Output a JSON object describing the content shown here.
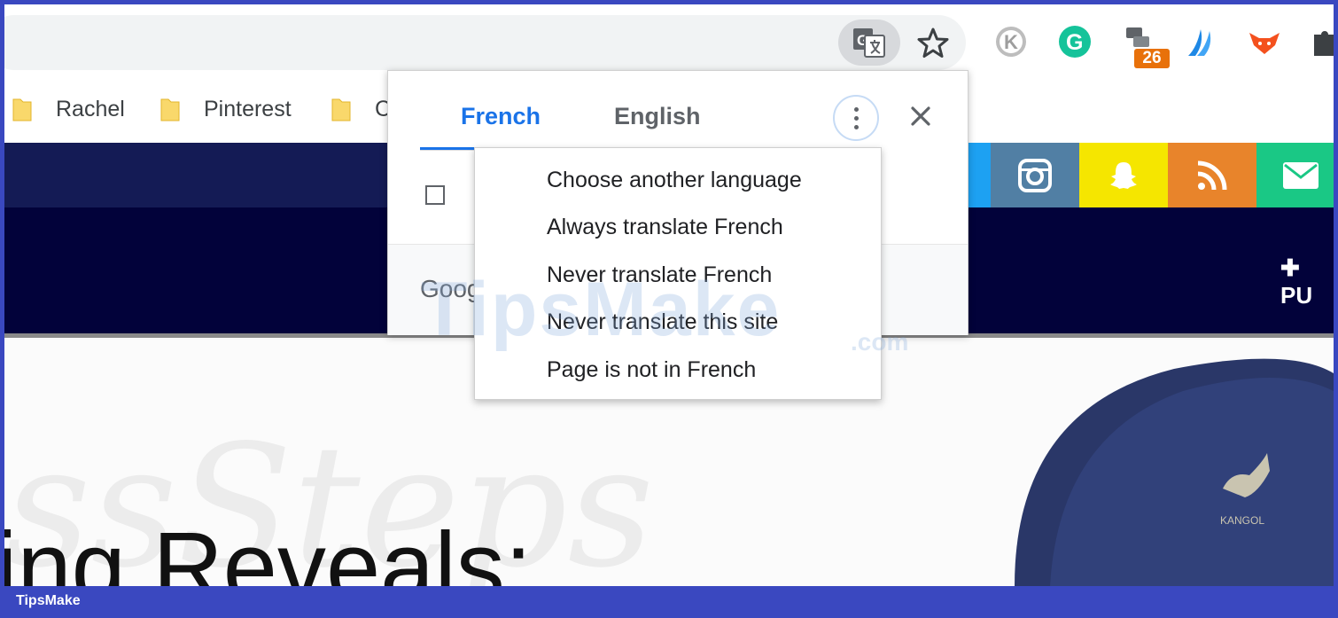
{
  "toolbar": {
    "translate_icon": "translate-icon",
    "bookmark_icon": "star-icon",
    "extensions": [
      {
        "name": "k-extension-icon",
        "letter": "K",
        "color": "#9e9e9e"
      },
      {
        "name": "grammarly-icon",
        "letter": "G",
        "color": "#15c39a"
      },
      {
        "name": "tab-manager-icon",
        "badge": "26",
        "badge_color": "#e8710a"
      },
      {
        "name": "wing-extension-icon",
        "color": "#1e88e5"
      },
      {
        "name": "fox-extension-icon",
        "color": "#f4511e"
      },
      {
        "name": "puzzle-icon",
        "color": "#3c4043"
      }
    ]
  },
  "bookmarks": [
    {
      "label": "Rachel"
    },
    {
      "label": "Pinterest"
    },
    {
      "label": "C"
    }
  ],
  "translate_bubble": {
    "tabs": [
      {
        "label": "French",
        "active": true
      },
      {
        "label": "English",
        "active": false
      }
    ],
    "footer_logo": "Goog",
    "accent_color": "#1a73e8"
  },
  "options_menu": {
    "items": [
      "Choose another language",
      "Always translate French",
      "Never translate French",
      "Never translate this site",
      "Page is not in French"
    ]
  },
  "page": {
    "publish_label": "✚ PU",
    "headline": "ing Reveals:",
    "social_colors": [
      "#1da1f2",
      "#517fa4",
      "#f5e600",
      "#e8842b",
      "#1ac885"
    ]
  },
  "watermark": {
    "brand": "TipsMake",
    "domain": ".com"
  },
  "site_bar": {
    "label": "TipsMake"
  }
}
